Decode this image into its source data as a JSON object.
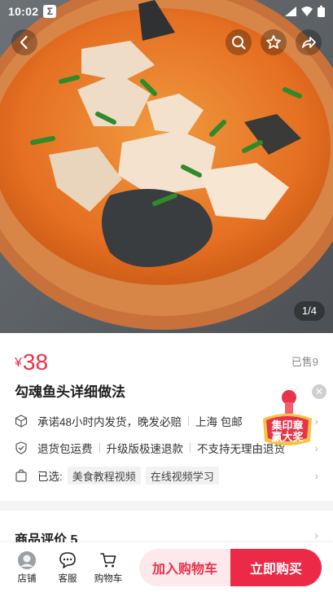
{
  "status_bar": {
    "time": "10:02",
    "app_badge": "Σ"
  },
  "gallery": {
    "pager": "1/4",
    "image_alt": "fish head soup in clay pot"
  },
  "product": {
    "currency": "¥",
    "price": "38",
    "sold": "已售9",
    "title": "勾魂鱼头详细做法"
  },
  "service": {
    "shipping": [
      "承诺48小时内发货，晚发必赔",
      "上海 包邮"
    ],
    "guarantees": [
      "退货包运费",
      "升级版极速退款",
      "不支持无理由退货"
    ],
    "selected_label": "已选:",
    "selected_chips": [
      "美食教程视频",
      "在线视频学习"
    ]
  },
  "promo": {
    "line1": "集印章",
    "line2": "赢大奖"
  },
  "reviews": {
    "title": "商品评价 5"
  },
  "bottom_nav": {
    "shop": "店铺",
    "service": "客服",
    "cart": "购物车"
  },
  "actions": {
    "add_to_cart": "加入购物车",
    "buy_now": "立即购买"
  },
  "colors": {
    "accent": "#ec2a47",
    "price": "#e8334a",
    "cart_bg": "#fde9ec"
  }
}
